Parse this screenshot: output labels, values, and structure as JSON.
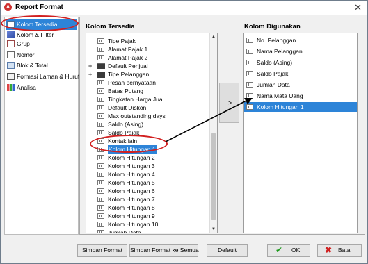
{
  "window": {
    "title": "Report Format",
    "close_glyph": "✕"
  },
  "nav": {
    "items": [
      {
        "label": "Kolom Tersedia",
        "icon": "table-icon"
      },
      {
        "label": "Kolom & Filter",
        "icon": "filter-icon"
      },
      {
        "label": "Grup",
        "icon": "group-icon"
      },
      {
        "label": "Nomor",
        "icon": "number-icon"
      },
      {
        "label": "Blok & Total",
        "icon": "block-icon"
      },
      {
        "label": "Formasi Laman & Huruf",
        "icon": "page-format-icon"
      },
      {
        "label": "Analisa",
        "icon": "chart-icon"
      }
    ]
  },
  "available": {
    "title": "Kolom Tersedia",
    "items": [
      {
        "label": "Tipe Pajak",
        "type": "field"
      },
      {
        "label": "Alamat Pajak 1",
        "type": "field"
      },
      {
        "label": "Alamat Pajak 2",
        "type": "field"
      },
      {
        "label": "Default Penjual",
        "type": "folder"
      },
      {
        "label": "Tipe Pelanggan",
        "type": "folder"
      },
      {
        "label": "Pesan pernyataan",
        "type": "field"
      },
      {
        "label": "Batas Putang",
        "type": "field"
      },
      {
        "label": "Tingkatan Harga Jual",
        "type": "field"
      },
      {
        "label": "Default Diskon",
        "type": "field"
      },
      {
        "label": "Max outstanding days",
        "type": "field"
      },
      {
        "label": "Saldo (Asing)",
        "type": "field"
      },
      {
        "label": "Saldo Pajak",
        "type": "field"
      },
      {
        "label": "Kontak lain",
        "type": "field"
      },
      {
        "label": "Kolom Hitungan 1",
        "type": "field"
      },
      {
        "label": "Kolom Hitungan 2",
        "type": "field"
      },
      {
        "label": "Kolom Hitungan 3",
        "type": "field"
      },
      {
        "label": "Kolom Hitungan 4",
        "type": "field"
      },
      {
        "label": "Kolom Hitungan 5",
        "type": "field"
      },
      {
        "label": "Kolom Hitungan 6",
        "type": "field"
      },
      {
        "label": "Kolom Hitungan 7",
        "type": "field"
      },
      {
        "label": "Kolom Hitungan 8",
        "type": "field"
      },
      {
        "label": "Kolom Hitungan 9",
        "type": "field"
      },
      {
        "label": "Kolom Hitungan 10",
        "type": "field"
      },
      {
        "label": "Jumlah Data",
        "type": "field"
      }
    ],
    "expander_glyph": "+"
  },
  "move_button_label": ">",
  "used": {
    "title": "Kolom Digunakan",
    "items": [
      {
        "label": "No. Pelanggan."
      },
      {
        "label": "Nama Pelanggan"
      },
      {
        "label": "Saldo (Asing)"
      },
      {
        "label": "Saldo Pajak"
      },
      {
        "label": "Jumlah Data"
      },
      {
        "label": "Nama Mata Uang"
      },
      {
        "label": "Kolom Hitungan 1"
      }
    ]
  },
  "buttons": {
    "save_format": "Simpan Format",
    "save_format_all": "Simpan Format ke Semua",
    "default": "Default",
    "ok": "OK",
    "ok_glyph": "✔",
    "cancel": "Batal",
    "cancel_glyph": "✖"
  },
  "scroll": {
    "up_glyph": "▲",
    "down_glyph": "▼"
  },
  "colors": {
    "selection": "#2d84d8",
    "annotation": "#d21f1f"
  }
}
